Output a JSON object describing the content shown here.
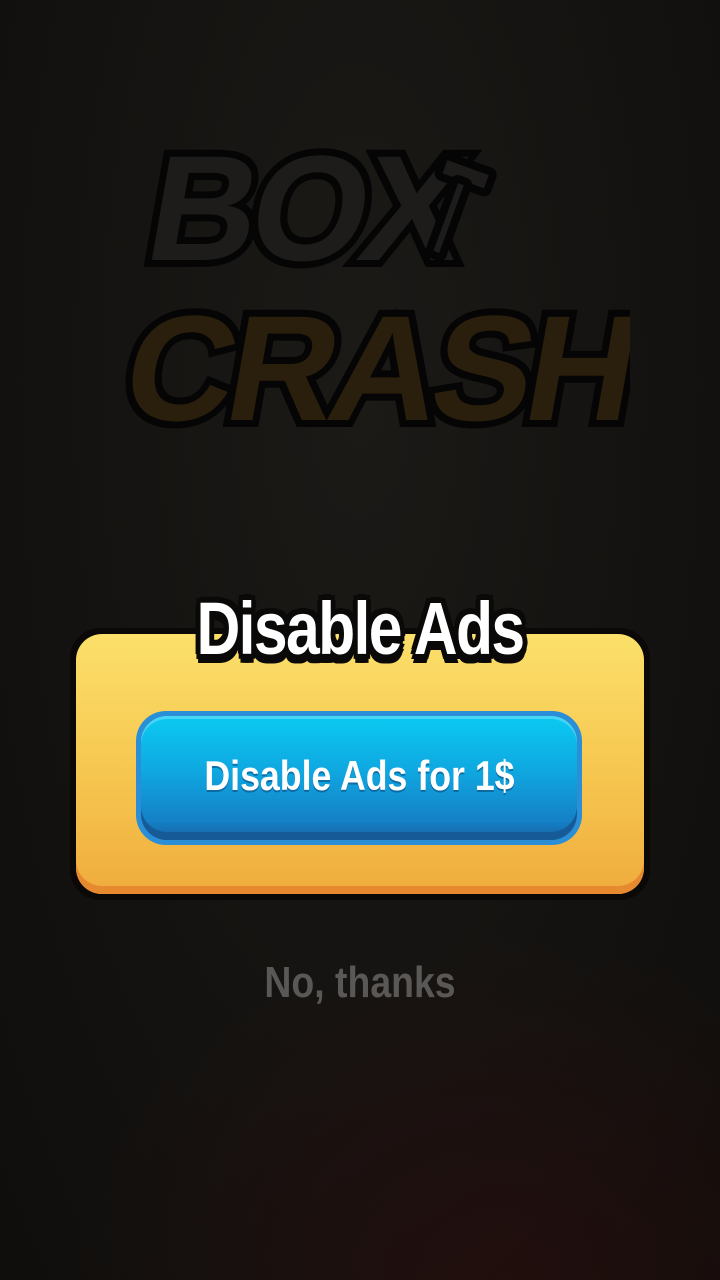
{
  "logo": {
    "line1": "BOX",
    "line2": "CRASH",
    "icon": "hammer-icon"
  },
  "dialog": {
    "title": "Disable Ads",
    "buy_button_label": "Disable Ads for 1$",
    "dismiss_label": "No, thanks"
  },
  "colors": {
    "panel_top": "#fbe06a",
    "panel_bottom": "#efac3d",
    "button_top": "#0bcaf2",
    "button_bottom": "#16629f",
    "dismiss_text": "#5a5856",
    "background": "#141210"
  }
}
